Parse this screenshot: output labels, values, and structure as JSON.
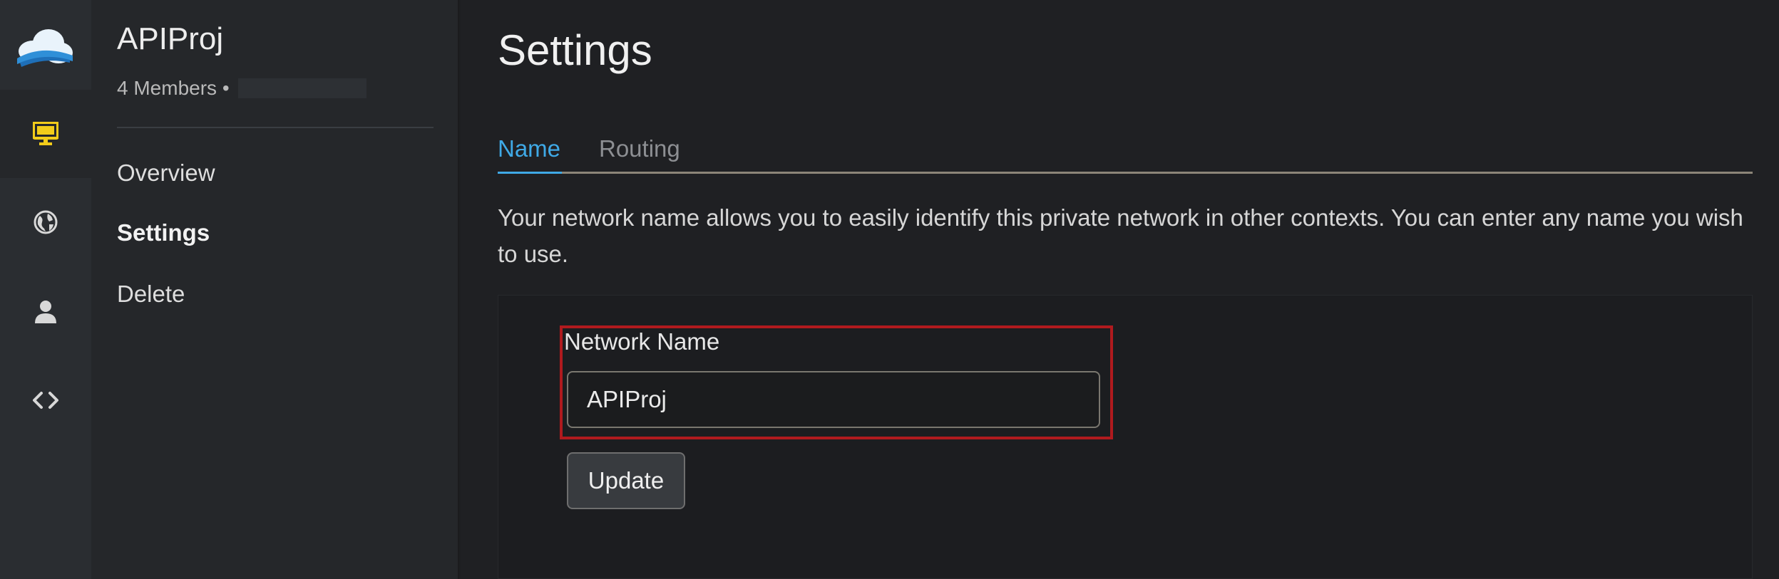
{
  "sidebar": {
    "project_name": "APIProj",
    "members": "4 Members •",
    "nav": [
      {
        "label": "Overview"
      },
      {
        "label": "Settings"
      },
      {
        "label": "Delete"
      }
    ]
  },
  "rail": {
    "items": [
      "monitor-icon",
      "globe-icon",
      "user-icon",
      "code-icon"
    ],
    "active_color": "#f2cc1a"
  },
  "main": {
    "title": "Settings",
    "tabs": [
      {
        "label": "Name",
        "active": true
      },
      {
        "label": "Routing",
        "active": false
      }
    ],
    "description": "Your network name allows you to easily identify this private network in other contexts. You can enter any name you wish to use.",
    "form": {
      "label": "Network Name",
      "value": "APIProj",
      "button": "Update"
    }
  },
  "colors": {
    "accent": "#3fa9e6",
    "highlight": "#b01a1e"
  }
}
